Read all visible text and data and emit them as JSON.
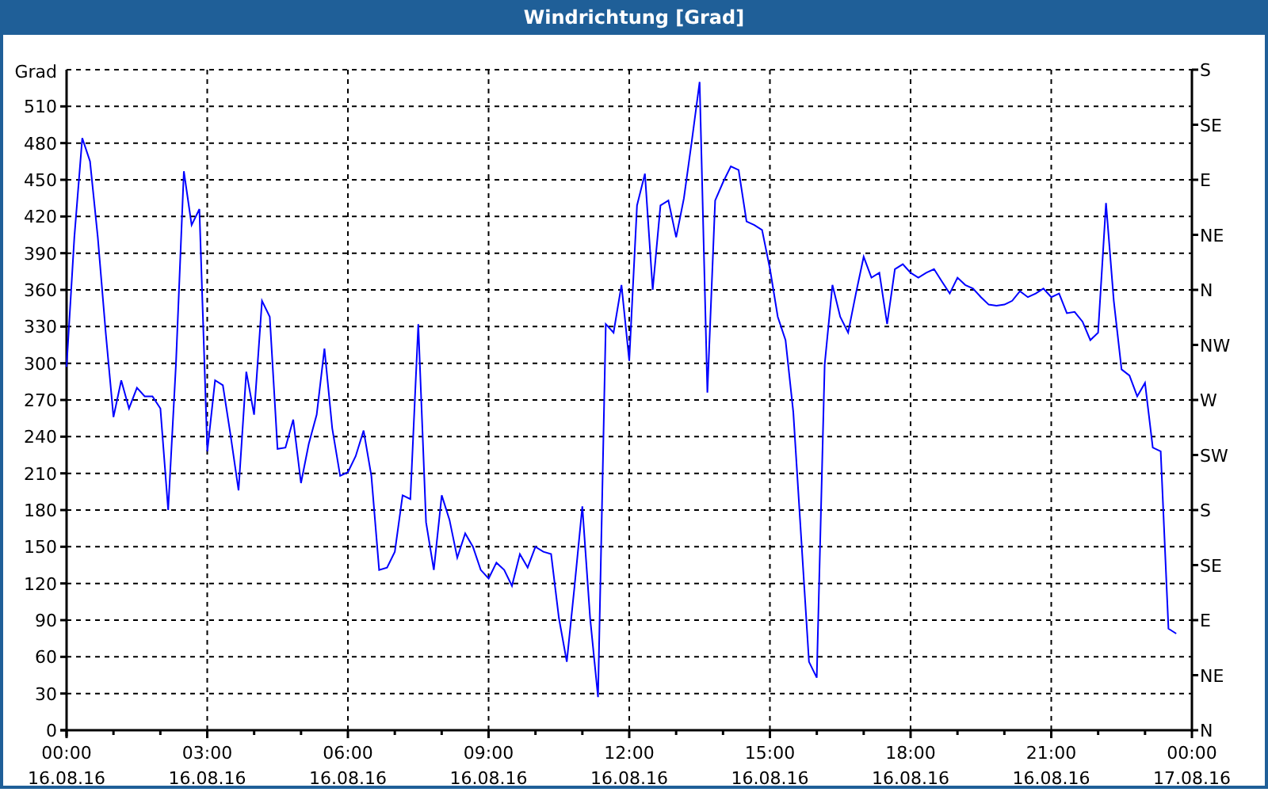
{
  "window": {
    "title": "Windrichtung [Grad]"
  },
  "chart": {
    "right_axis_labels": [
      "S",
      "SE",
      "E",
      "NE",
      "N",
      "NW",
      "W",
      "SW",
      "S",
      "SE",
      "E",
      "NE",
      "N"
    ],
    "chart_data": {
      "type": "line",
      "grid": true,
      "ylabel": "Grad",
      "ylim": [
        0,
        540
      ],
      "categories": [
        "00:00\n16.08.16",
        null,
        null,
        null,
        null,
        null,
        null,
        null,
        null,
        null,
        null,
        null,
        null,
        null,
        null,
        null,
        null,
        null,
        "03:00\n16.08.16",
        null,
        null,
        null,
        null,
        null,
        null,
        null,
        null,
        null,
        null,
        null,
        null,
        null,
        null,
        null,
        null,
        null,
        "06:00\n16.08.16",
        null,
        null,
        null,
        null,
        null,
        null,
        null,
        null,
        null,
        null,
        null,
        null,
        null,
        null,
        null,
        null,
        null,
        "09:00\n16.08.16",
        null,
        null,
        null,
        null,
        null,
        null,
        null,
        null,
        null,
        null,
        null,
        null,
        null,
        null,
        null,
        null,
        null,
        "12:00\n16.08.16",
        null,
        null,
        null,
        null,
        null,
        null,
        null,
        null,
        null,
        null,
        null,
        null,
        null,
        null,
        null,
        null,
        null,
        "15:00\n16.08.16",
        null,
        null,
        null,
        null,
        null,
        null,
        null,
        null,
        null,
        null,
        null,
        null,
        null,
        null,
        null,
        null,
        null,
        "18:00\n16.08.16",
        null,
        null,
        null,
        null,
        null,
        null,
        null,
        null,
        null,
        null,
        null,
        null,
        null,
        null,
        null,
        null,
        null,
        "21:00\n16.08.16",
        null,
        null,
        null,
        null,
        null,
        null,
        null,
        null,
        null,
        null,
        null,
        null,
        null,
        null,
        null,
        null,
        null,
        "00:00\n17.08.16"
      ],
      "yticks": [
        0,
        30,
        60,
        90,
        120,
        150,
        180,
        210,
        240,
        270,
        300,
        330,
        360,
        390,
        420,
        450,
        480,
        510
      ],
      "series": [
        {
          "color": "#0000ff",
          "values": [
            297,
            403,
            484,
            465,
            403,
            325,
            256,
            286,
            263,
            280,
            273,
            273,
            263,
            180,
            299,
            457,
            413,
            426,
            228,
            286,
            282,
            241,
            196,
            293,
            258,
            351,
            338,
            230,
            231,
            254,
            202,
            234,
            258,
            312,
            247,
            208,
            211,
            224,
            245,
            208,
            131,
            133,
            146,
            192,
            189,
            332,
            170,
            131,
            192,
            172,
            141,
            161,
            150,
            131,
            124,
            137,
            131,
            118,
            144,
            133,
            150,
            146,
            144,
            92,
            56,
            118,
            183,
            92,
            27,
            332,
            325,
            364,
            302,
            429,
            455,
            360,
            429,
            433,
            403,
            435,
            481,
            530,
            276,
            433,
            448,
            461,
            458,
            416,
            413,
            409,
            377,
            338,
            319,
            260,
            157,
            56,
            43,
            299,
            364,
            338,
            325,
            357,
            387,
            370,
            374,
            332,
            377,
            381,
            374,
            370,
            374,
            377,
            367,
            357,
            370,
            364,
            361,
            354,
            348,
            347,
            348,
            351,
            359,
            354,
            357,
            361,
            354,
            357,
            341,
            342,
            334,
            319,
            325,
            431,
            351,
            295,
            290,
            273,
            284,
            231,
            228,
            83,
            79,
            null,
            null
          ]
        }
      ]
    }
  }
}
